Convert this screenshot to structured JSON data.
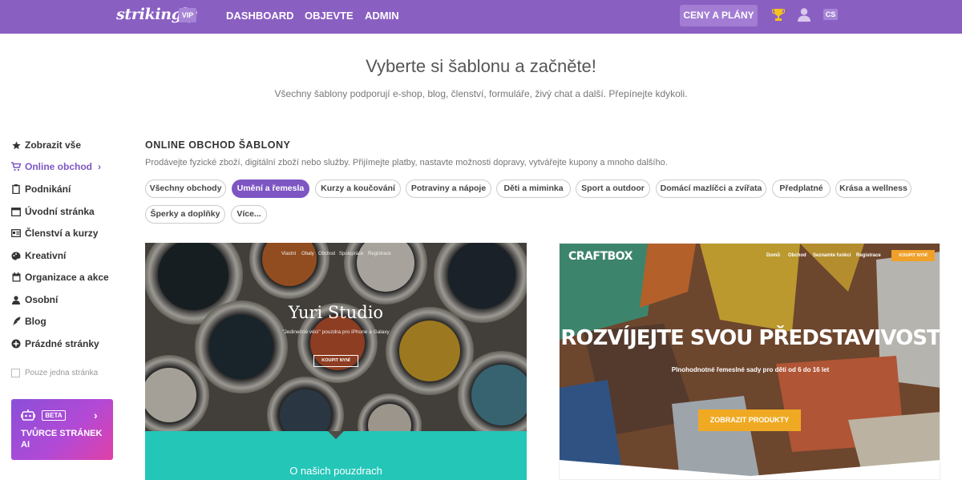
{
  "topbar": {
    "logo": "strikingly",
    "vip": "VIP",
    "nav": [
      "DASHBOARD",
      "OBJEVTE",
      "ADMIN"
    ],
    "pricing": "CENY A PLÁNY",
    "lang": "CS",
    "icons": [
      "trophy-icon",
      "user-icon"
    ],
    "color": "#8a5fc2"
  },
  "hero": {
    "title": "Vyberte si šablonu a začněte!",
    "subtitle": "Všechny šablony podporují e-shop, blog, členství, formuláře, živý chat a další. Přepínejte kdykoli."
  },
  "sidebar": {
    "items": [
      {
        "label": "Zobrazit vše",
        "icon": "star-icon"
      },
      {
        "label": "Online obchod",
        "icon": "cart-icon",
        "active": true
      },
      {
        "label": "Podnikání",
        "icon": "clipboard-icon"
      },
      {
        "label": "Úvodní stránka",
        "icon": "window-icon"
      },
      {
        "label": "Členství a kurzy",
        "icon": "id-card-icon"
      },
      {
        "label": "Kreativní",
        "icon": "palette-icon"
      },
      {
        "label": "Organizace a akce",
        "icon": "calendar-icon"
      },
      {
        "label": "Osobní",
        "icon": "person-icon"
      },
      {
        "label": "Blog",
        "icon": "quill-icon"
      },
      {
        "label": "Prázdné stránky",
        "icon": "plus-circle-icon"
      }
    ],
    "single_page": "Pouze jedna stránka",
    "ai_card": {
      "beta": "BETA",
      "title": "TVŮRCE STRÁNEK AI"
    }
  },
  "main": {
    "section_title": "ONLINE OBCHOD ŠABLONY",
    "section_desc": "Prodávejte fyzické zboží, digitální zboží nebo služby. Přijímejte platby, nastavte možnosti dopravy, vytvářejte kupony a mnoho dalšího.",
    "chips": [
      "Všechny obchody",
      "Umění a řemesla",
      "Kurzy a koučování",
      "Potraviny a nápoje",
      "Děti a miminka",
      "Sport a outdoor",
      "Domácí mazlíčci a zvířata",
      "Předplatné",
      "Krása a wellness",
      "Šperky a doplňky",
      "Více..."
    ],
    "active_chip": "Umění a řemesla",
    "accent": "#7d56c3"
  },
  "templates": [
    {
      "nav": [
        "Vlastní",
        "Obaly",
        "Obchod",
        "Spolupráce",
        "Registrace"
      ],
      "title": "Yuri Studio",
      "subtitle": "\"Jedinečné věci\" pouzdra pro iPhone a Galaxy",
      "button": "KOUPIT NYNÍ",
      "about": "O našich pouzdrach"
    },
    {
      "logo": "CRAFTBOX",
      "nav": [
        "Domů",
        "Obchod",
        "Seznamte funkcí",
        "Registrace"
      ],
      "buy": "KOUPIT NYNÍ",
      "headline": "ROZVÍJEJTE SVOU PŘEDSTAVIVOST",
      "subtitle": "Plnohodnotné řemeslné sady pro děti od 6 do 16 let",
      "button": "ZOBRAZIT PRODUKTY"
    }
  ]
}
